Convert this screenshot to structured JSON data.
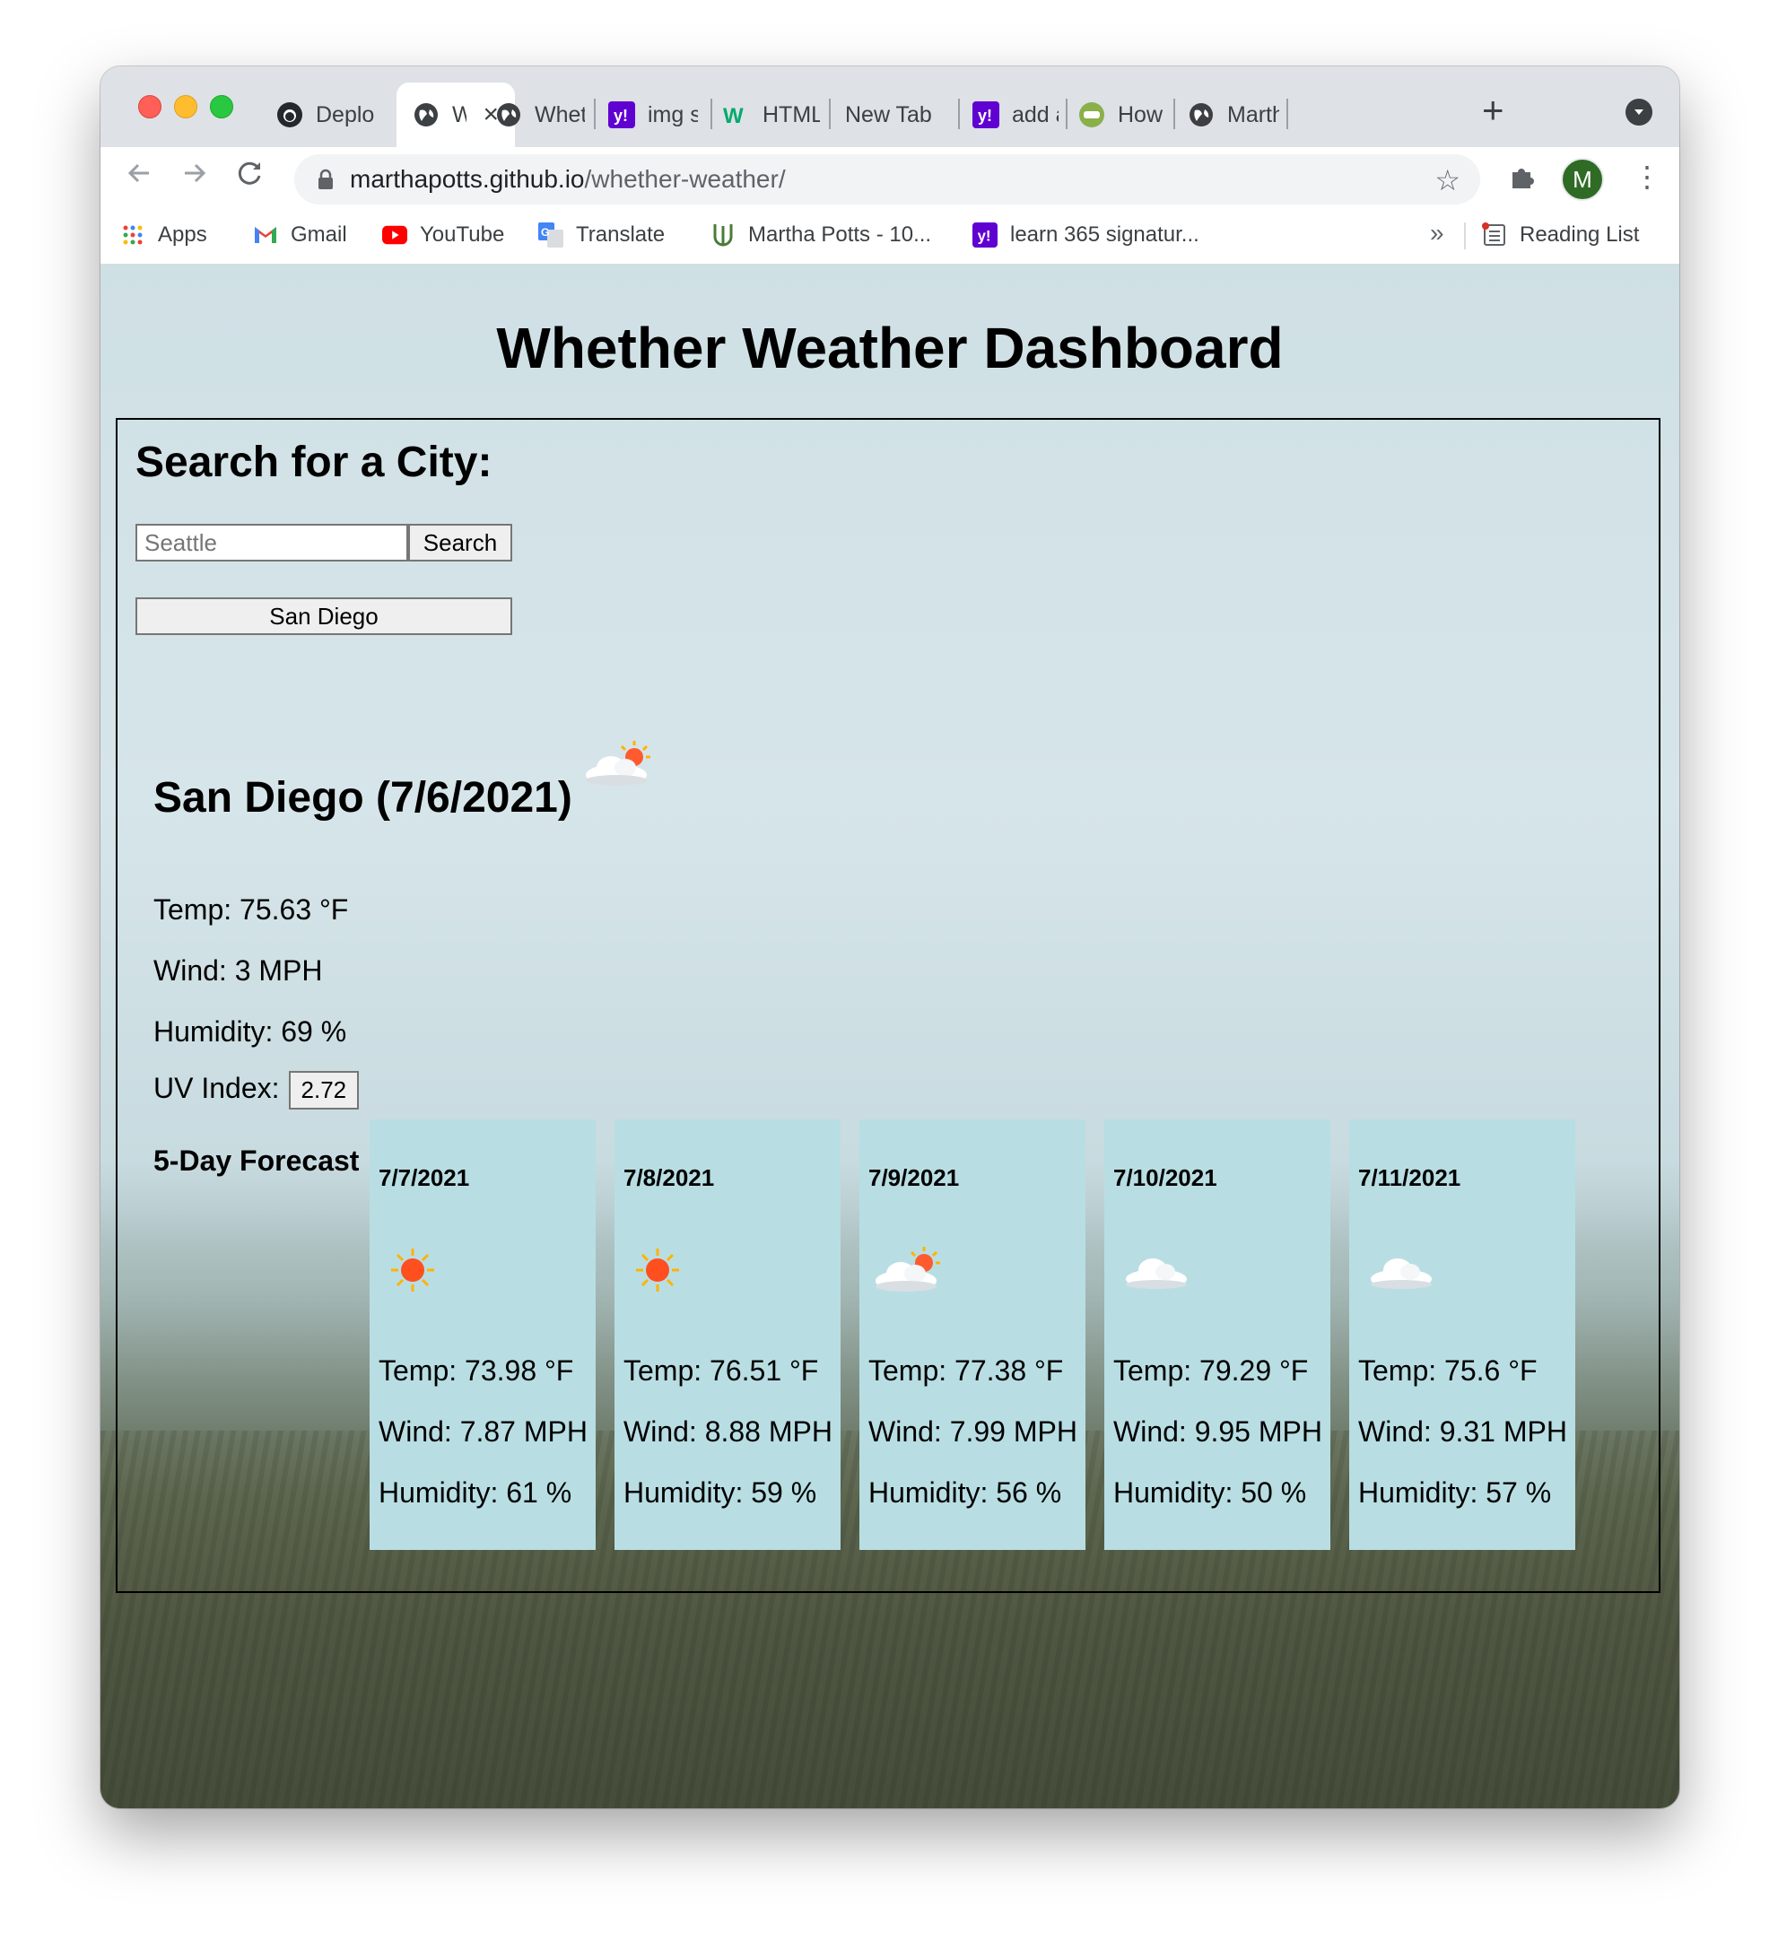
{
  "browser": {
    "tabs": [
      {
        "label": "Deplo",
        "icon": "github-icon"
      },
      {
        "label": "Wl",
        "icon": "globe-icon",
        "active": true
      },
      {
        "label": "Wheth",
        "icon": "globe-icon"
      },
      {
        "label": "img sr",
        "icon": "yahoo-icon"
      },
      {
        "label": "HTML",
        "icon": "w3-icon"
      },
      {
        "label": "New Tab",
        "icon": ""
      },
      {
        "label": "add a",
        "icon": "yahoo-icon"
      },
      {
        "label": "How t",
        "icon": "jw-icon"
      },
      {
        "label": "Marth",
        "icon": "globe-icon"
      }
    ],
    "url_domain": "marthapotts.github.io",
    "url_path": "/whether-weather/",
    "profile_initial": "M",
    "bookmarks": [
      {
        "label": "Apps",
        "icon": "apps-grid-icon"
      },
      {
        "label": "Gmail",
        "icon": "gmail-icon"
      },
      {
        "label": "YouTube",
        "icon": "youtube-icon"
      },
      {
        "label": "Translate",
        "icon": "translate-icon"
      },
      {
        "label": "Martha Potts - 10...",
        "icon": "uw-icon"
      },
      {
        "label": "learn 365 signatur...",
        "icon": "yahoo-icon"
      }
    ],
    "reading_list": "Reading List"
  },
  "page": {
    "title": "Whether Weather Dashboard",
    "search_heading": "Search for a City:",
    "search_placeholder": "Seattle",
    "search_button": "Search",
    "history": [
      "San Diego"
    ],
    "current": {
      "heading": "San Diego (7/6/2021)",
      "icon": "partly-cloudy-icon",
      "temp": "Temp: 75.63 °F",
      "wind": "Wind: 3 MPH",
      "humidity": "Humidity: 69 %",
      "uv_label": "UV Index:",
      "uv_value": "2.72"
    },
    "forecast_label": "5-Day Forecast",
    "forecast": [
      {
        "date": "7/7/2021",
        "icon": "sun-icon",
        "temp": "Temp: 73.98 °F",
        "wind": "Wind: 7.87 MPH",
        "humidity": "Humidity: 61 %"
      },
      {
        "date": "7/8/2021",
        "icon": "sun-icon",
        "temp": "Temp: 76.51 °F",
        "wind": "Wind: 8.88 MPH",
        "humidity": "Humidity: 59 %"
      },
      {
        "date": "7/9/2021",
        "icon": "partly-cloudy-icon",
        "temp": "Temp: 77.38 °F",
        "wind": "Wind: 7.99 MPH",
        "humidity": "Humidity: 56 %"
      },
      {
        "date": "7/10/2021",
        "icon": "cloud-icon",
        "temp": "Temp: 79.29 °F",
        "wind": "Wind: 9.95 MPH",
        "humidity": "Humidity: 50 %"
      },
      {
        "date": "7/11/2021",
        "icon": "cloud-icon",
        "temp": "Temp: 75.6 °F",
        "wind": "Wind: 9.31 MPH",
        "humidity": "Humidity: 57 %"
      }
    ]
  },
  "colors": {
    "forecast_card": "#b8dee3",
    "profile": "#2f6b25"
  }
}
